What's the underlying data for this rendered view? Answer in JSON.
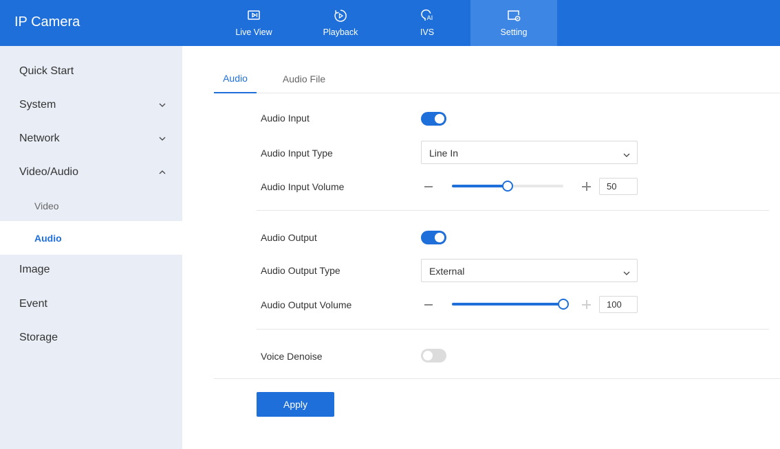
{
  "app": {
    "title": "IP Camera"
  },
  "nav": [
    {
      "label": "Live View",
      "icon": "live-view-icon"
    },
    {
      "label": "Playback",
      "icon": "playback-icon"
    },
    {
      "label": "IVS",
      "icon": "ivs-icon"
    },
    {
      "label": "Setting",
      "icon": "setting-icon",
      "active": true
    }
  ],
  "sidebar": {
    "items": [
      {
        "label": "Quick Start"
      },
      {
        "label": "System",
        "expanded": false
      },
      {
        "label": "Network",
        "expanded": false
      },
      {
        "label": "Video/Audio",
        "expanded": true
      },
      {
        "label": "Image"
      },
      {
        "label": "Event"
      },
      {
        "label": "Storage"
      }
    ],
    "subitems": [
      {
        "label": "Video"
      },
      {
        "label": "Audio",
        "selected": true
      }
    ]
  },
  "tabs": [
    {
      "label": "Audio",
      "active": true
    },
    {
      "label": "Audio File"
    }
  ],
  "form": {
    "audio_input": {
      "label": "Audio Input",
      "on": true
    },
    "audio_input_type": {
      "label": "Audio Input Type",
      "value": "Line In"
    },
    "audio_input_volume": {
      "label": "Audio Input Volume",
      "value": "50",
      "level": 50
    },
    "audio_output": {
      "label": "Audio Output",
      "on": true
    },
    "audio_output_type": {
      "label": "Audio Output Type",
      "value": "External"
    },
    "audio_output_volume": {
      "label": "Audio Output Volume",
      "value": "100",
      "level": 100
    },
    "voice_denoise": {
      "label": "Voice Denoise",
      "on": false
    }
  },
  "actions": {
    "apply_label": "Apply"
  },
  "colors": {
    "accent": "#1e6fd9",
    "sidebar_bg": "#e9eef6",
    "toggle_off": "#dcdcdc"
  }
}
